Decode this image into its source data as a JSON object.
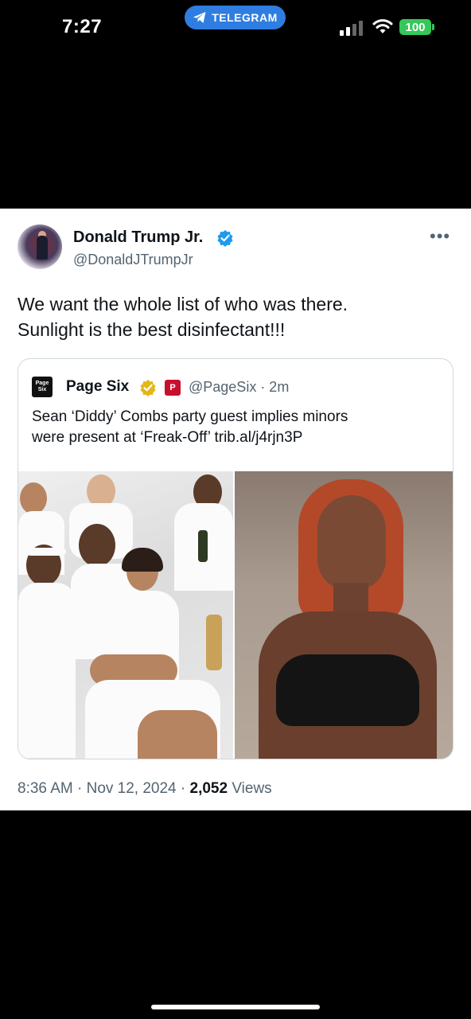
{
  "status_bar": {
    "time": "7:27",
    "pill_app": "TELEGRAM",
    "battery": "100",
    "pill_color": "#2f7de1",
    "battery_color": "#34c759"
  },
  "tweet": {
    "author_name": "Donald Trump Jr.",
    "handle": "@DonaldJTrumpJr",
    "more_icon": "more-icon",
    "text_lines": [
      "We want the whole list of who was there.",
      "Sunlight is the best disinfectant!!!"
    ],
    "quote": {
      "logo_text": "Page Six",
      "author_name": "Page Six",
      "handle_time": "@PageSix · 2m",
      "badge_text": "P",
      "text_lines": [
        "Sean ‘Diddy’ Combs party guest implies minors",
        "were present at ‘Freak-Off’ trib.al/j4rjn3P"
      ]
    },
    "timestamp": "8:36 AM · Nov 12, 2024 · ",
    "views_count": "2,052",
    "views_label": " Views",
    "verified_color": "#1d9bf0"
  }
}
